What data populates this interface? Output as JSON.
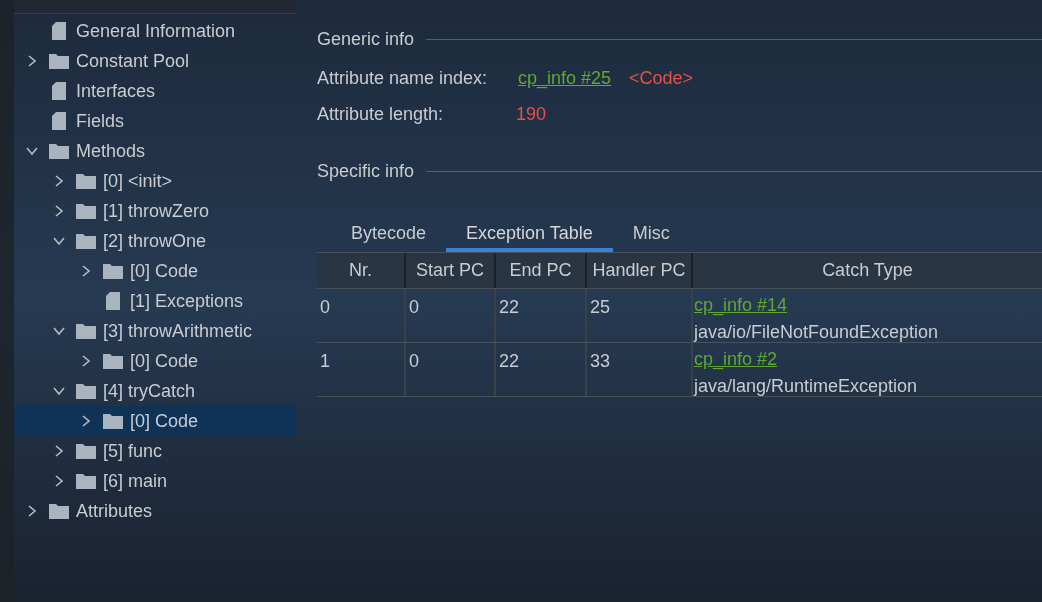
{
  "tree": [
    {
      "label": "General Information",
      "kind": "file",
      "selected": false
    },
    {
      "label": "Constant Pool",
      "kind": "folder",
      "expanded": false,
      "selected": false
    },
    {
      "label": "Interfaces",
      "kind": "file",
      "selected": false
    },
    {
      "label": "Fields",
      "kind": "file",
      "selected": false
    },
    {
      "label": "Methods",
      "kind": "folder",
      "expanded": true,
      "selected": false,
      "children": [
        {
          "label": "[0] <init>",
          "kind": "folder",
          "expanded": false,
          "selected": false
        },
        {
          "label": "[1] throwZero",
          "kind": "folder",
          "expanded": false,
          "selected": false
        },
        {
          "label": "[2] throwOne",
          "kind": "folder",
          "expanded": true,
          "selected": false,
          "children": [
            {
              "label": "[0] Code",
              "kind": "folder",
              "expanded": false,
              "selected": false
            },
            {
              "label": "[1] Exceptions",
              "kind": "file",
              "selected": false
            }
          ]
        },
        {
          "label": "[3] throwArithmetic",
          "kind": "folder",
          "expanded": true,
          "selected": false,
          "children": [
            {
              "label": "[0] Code",
              "kind": "folder",
              "expanded": false,
              "selected": false
            }
          ]
        },
        {
          "label": "[4] tryCatch",
          "kind": "folder",
          "expanded": true,
          "selected": false,
          "children": [
            {
              "label": "[0] Code",
              "kind": "folder",
              "expanded": false,
              "selected": true
            }
          ]
        },
        {
          "label": "[5] func",
          "kind": "folder",
          "expanded": false,
          "selected": false
        },
        {
          "label": "[6] main",
          "kind": "folder",
          "expanded": false,
          "selected": false
        }
      ]
    },
    {
      "label": "Attributes",
      "kind": "folder",
      "expanded": false,
      "selected": false
    }
  ],
  "generic_info": {
    "title": "Generic info",
    "name_index": {
      "label": "Attribute name index:",
      "link": "cp_info #25",
      "value": "<Code>"
    },
    "length": {
      "label": "Attribute length:",
      "value": "190"
    }
  },
  "specific_info": {
    "title": "Specific info",
    "tabs": [
      {
        "label": "Bytecode",
        "selected": false
      },
      {
        "label": "Exception Table",
        "selected": true
      },
      {
        "label": "Misc",
        "selected": false
      }
    ],
    "table": {
      "columns": [
        "Nr.",
        "Start PC",
        "End PC",
        "Handler PC",
        "Catch Type"
      ],
      "rows": [
        {
          "cells": [
            "0",
            "0",
            "22",
            "25"
          ],
          "catch_link": "cp_info #14",
          "catch_type": "java/io/FileNotFoundException"
        },
        {
          "cells": [
            "1",
            "0",
            "22",
            "33"
          ],
          "catch_link": "cp_info #2",
          "catch_type": "java/lang/RuntimeException"
        }
      ]
    }
  }
}
